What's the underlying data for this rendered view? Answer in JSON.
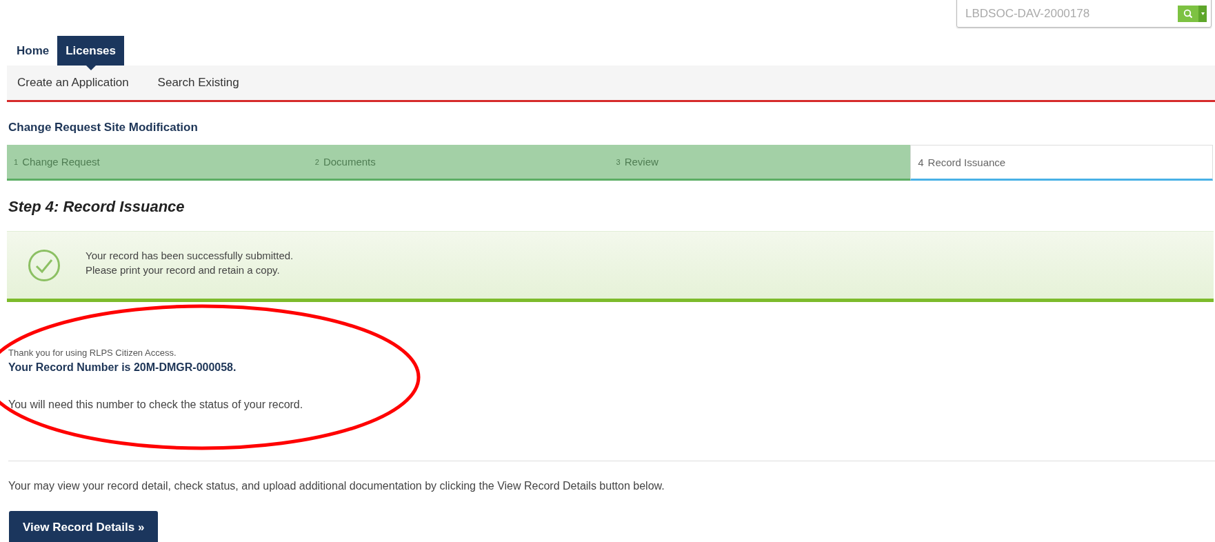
{
  "search": {
    "placeholder": "LBDSOC-DAV-2000178"
  },
  "nav": {
    "tabs": [
      {
        "label": "Home",
        "selected": false
      },
      {
        "label": "Licenses",
        "selected": true
      }
    ],
    "subnav": [
      "Create an Application",
      "Search Existing"
    ]
  },
  "page_title": "Change Request Site Modification",
  "steps": [
    {
      "number": "1",
      "label": "Change Request",
      "selected": false
    },
    {
      "number": "2",
      "label": "Documents",
      "selected": false
    },
    {
      "number": "3",
      "label": "Review",
      "selected": false
    },
    {
      "number": "4",
      "label": "Record Issuance",
      "selected": true
    }
  ],
  "step_heading": "Step 4: Record Issuance",
  "success": {
    "lines": [
      "Your record has been successfully submitted.",
      "Please print your record and retain a copy."
    ]
  },
  "thanks": "Thank you for using RLPS Citizen Access.",
  "record_number": "Your Record Number is 20M-DMGR-000058.",
  "note": "You will need this number to check the status of your record.",
  "info": "Your may view your record detail, check status, and upload additional documentation by clicking the View Record Details button below.",
  "button": "View Record Details »"
}
